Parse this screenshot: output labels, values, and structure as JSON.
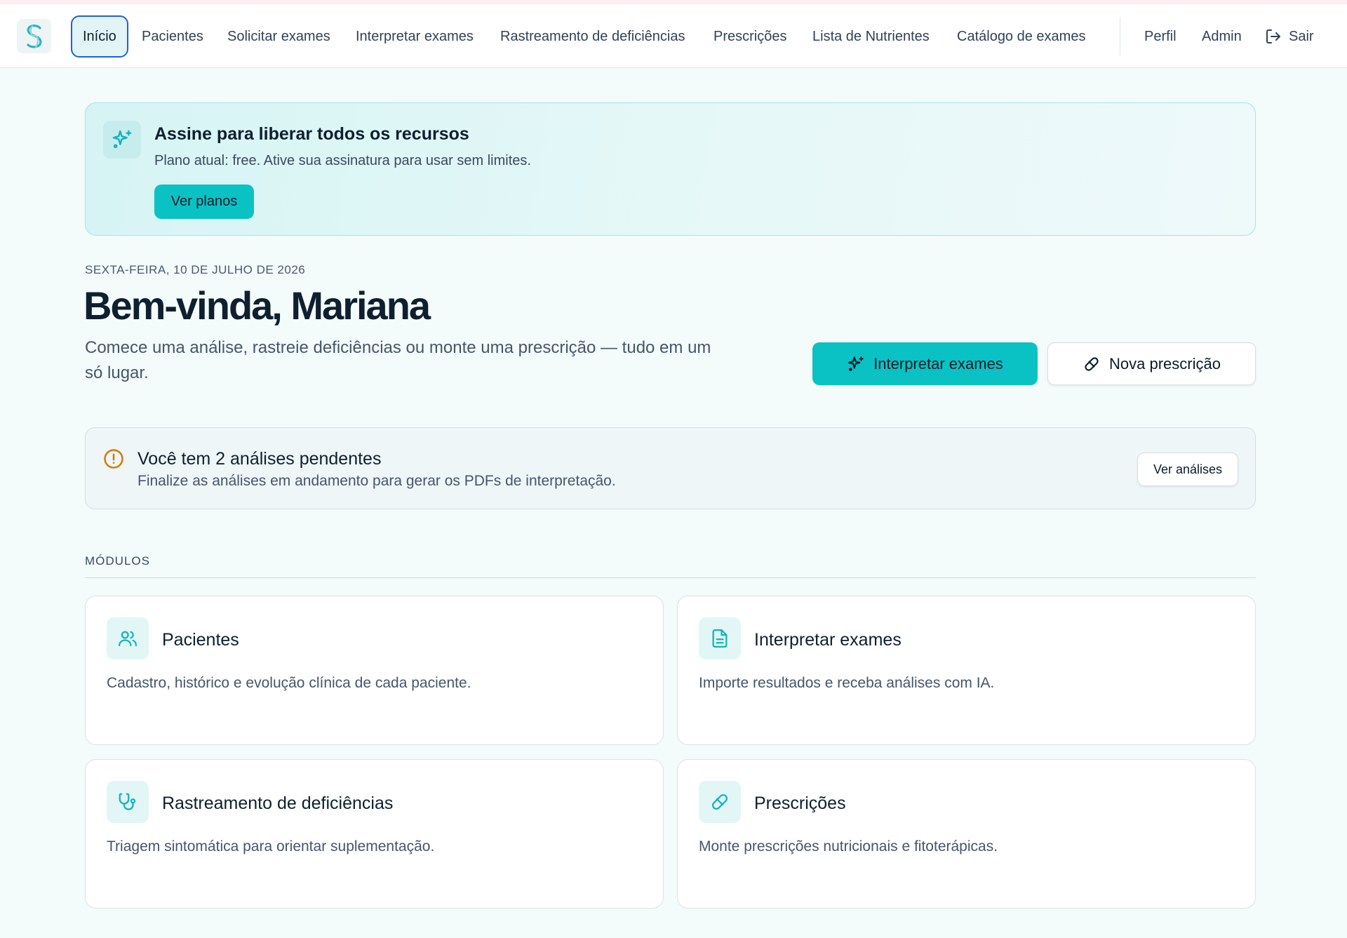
{
  "nav": {
    "items": [
      {
        "label": "Início"
      },
      {
        "label": "Pacientes"
      },
      {
        "label": "Solicitar exames"
      },
      {
        "label": "Interpretar exames"
      },
      {
        "label": "Rastreamento de deficiências"
      },
      {
        "label": "Prescrições"
      },
      {
        "label": "Lista de Nutrientes"
      },
      {
        "label": "Catálogo de exames"
      }
    ],
    "right": {
      "profile": "Perfil",
      "admin": "Admin",
      "logout": "Sair"
    }
  },
  "banner": {
    "title": "Assine para liberar todos os recursos",
    "subtitle": "Plano atual: free. Ative sua assinatura para usar sem limites.",
    "button": "Ver planos"
  },
  "hero": {
    "date": "SEXTA-FEIRA, 10 DE JULHO DE 2026",
    "welcome": "Bem-vinda, Mariana",
    "lead": "Comece uma análise, rastreie deficiências ou monte uma prescrição — tudo em um só lugar.",
    "primary_button": "Interpretar exames",
    "secondary_button": "Nova prescrição"
  },
  "pending": {
    "title": "Você tem 2 análises pendentes",
    "subtitle": "Finalize as análises em andamento para gerar os PDFs de interpretação.",
    "button": "Ver análises"
  },
  "modules": {
    "label": "MÓDULOS",
    "cards": [
      {
        "title": "Pacientes",
        "desc": "Cadastro, histórico e evolução clínica de cada paciente.",
        "icon": "users-icon"
      },
      {
        "title": "Interpretar exames",
        "desc": "Importe resultados e receba análises com IA.",
        "icon": "document-icon"
      },
      {
        "title": "Rastreamento de deficiências",
        "desc": "Triagem sintomática para orientar suplementação.",
        "icon": "stethoscope-icon"
      },
      {
        "title": "Prescrições",
        "desc": "Monte prescrições nutricionais e fitoterápicas.",
        "icon": "pill-icon"
      }
    ]
  },
  "colors": {
    "accent": "#0ac2c4",
    "warning": "#d97706",
    "active_outline": "#1e63d6"
  }
}
